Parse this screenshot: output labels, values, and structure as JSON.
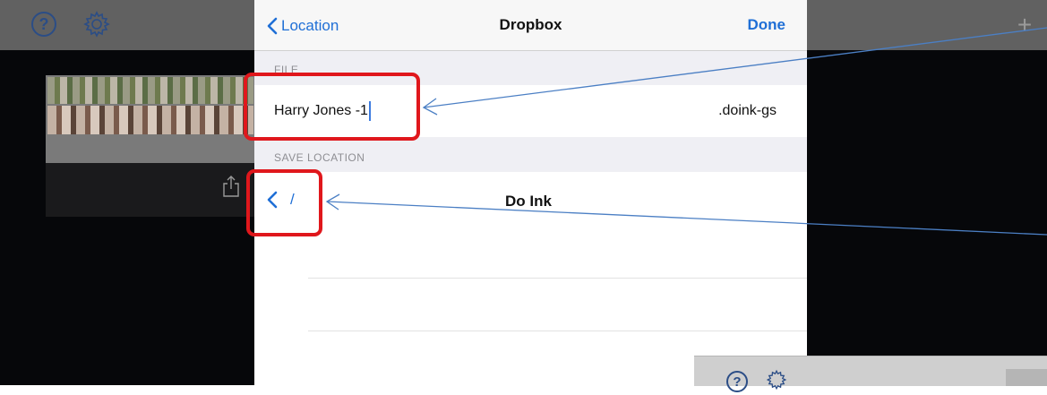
{
  "background_app": {
    "help_icon": "?",
    "plus_icon": "+"
  },
  "navbar": {
    "back_label": "Location",
    "title": "Dropbox",
    "done_label": "Done"
  },
  "file_section": {
    "header": "FILE",
    "filename_value": "Harry Jones -1",
    "extension": ".doink-gs"
  },
  "save_section": {
    "header": "SAVE LOCATION",
    "path_label": "/",
    "folder_name": "Do Ink"
  },
  "mini_screenshot": {
    "help_icon": "?"
  },
  "colors": {
    "accent": "#1f6fd6",
    "highlight": "#e0171c",
    "annotation_arrow": "#4b7fc4"
  }
}
